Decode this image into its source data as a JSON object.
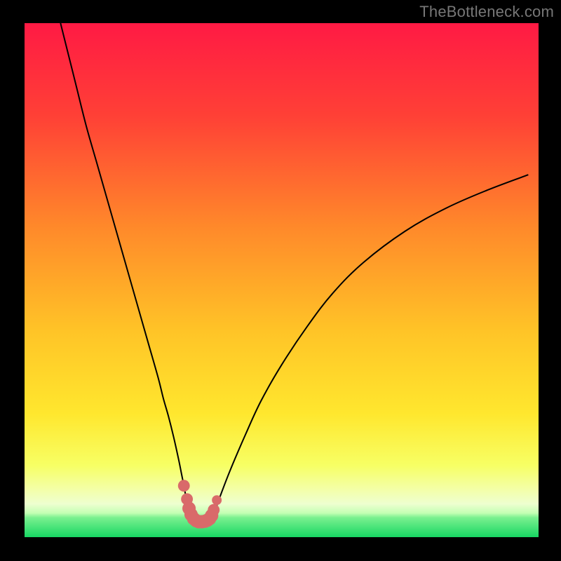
{
  "watermark": "TheBottleneck.com",
  "colors": {
    "frame_bg": "#000000",
    "gradient_top": "#ff1a44",
    "gradient_mid1": "#ff7a2b",
    "gradient_mid2": "#ffd82a",
    "gradient_mid3": "#f8ff66",
    "gradient_band": "#f4ffb0",
    "gradient_green": "#1fe26b",
    "curve_stroke": "#000000",
    "marker_fill": "#d96a6a",
    "marker_fill_dark": "#c95a5a",
    "watermark_color": "#777777"
  },
  "chart_data": {
    "type": "line",
    "title": "",
    "xlabel": "",
    "ylabel": "",
    "xlim": [
      0,
      100
    ],
    "ylim": [
      0,
      100
    ],
    "series": [
      {
        "name": "curve",
        "x": [
          7,
          8,
          9,
          10,
          12,
          14,
          16,
          18,
          20,
          22,
          24,
          26,
          27,
          28,
          29,
          30,
          30.5,
          31,
          31.5,
          32,
          32.8,
          33.6,
          34.5,
          35.4,
          36,
          36.5,
          37,
          38,
          40,
          43,
          46,
          50,
          55,
          60,
          66,
          74,
          82,
          90,
          98
        ],
        "y": [
          100,
          96,
          92,
          88,
          80,
          73,
          66,
          59,
          52,
          45,
          38,
          31,
          27,
          23.5,
          19.5,
          15,
          12.5,
          10,
          7.3,
          5.2,
          3.6,
          3.1,
          3.0,
          3.1,
          3.3,
          3.8,
          5.0,
          7.8,
          13,
          20,
          26.5,
          33.5,
          41,
          47.5,
          53.5,
          59.5,
          64,
          67.5,
          70.5
        ]
      }
    ],
    "markers": {
      "name": "sweet-spot",
      "color": "#d96a6a",
      "points": [
        {
          "x": 31.0,
          "y": 10.0,
          "r": 1.15
        },
        {
          "x": 31.6,
          "y": 7.4,
          "r": 1.15
        },
        {
          "x": 32.0,
          "y": 5.6,
          "r": 1.3
        },
        {
          "x": 32.4,
          "y": 4.4,
          "r": 1.3
        },
        {
          "x": 32.9,
          "y": 3.6,
          "r": 1.3
        },
        {
          "x": 33.4,
          "y": 3.2,
          "r": 1.3
        },
        {
          "x": 33.9,
          "y": 3.0,
          "r": 1.3
        },
        {
          "x": 34.5,
          "y": 3.0,
          "r": 1.3
        },
        {
          "x": 35.1,
          "y": 3.1,
          "r": 1.3
        },
        {
          "x": 35.6,
          "y": 3.3,
          "r": 1.3
        },
        {
          "x": 36.0,
          "y": 3.6,
          "r": 1.3
        },
        {
          "x": 36.4,
          "y": 4.2,
          "r": 1.3
        },
        {
          "x": 36.8,
          "y": 5.3,
          "r": 1.15
        },
        {
          "x": 37.4,
          "y": 7.2,
          "r": 0.95
        }
      ]
    },
    "green_band": {
      "y0": 0,
      "y1": 4.5
    }
  }
}
